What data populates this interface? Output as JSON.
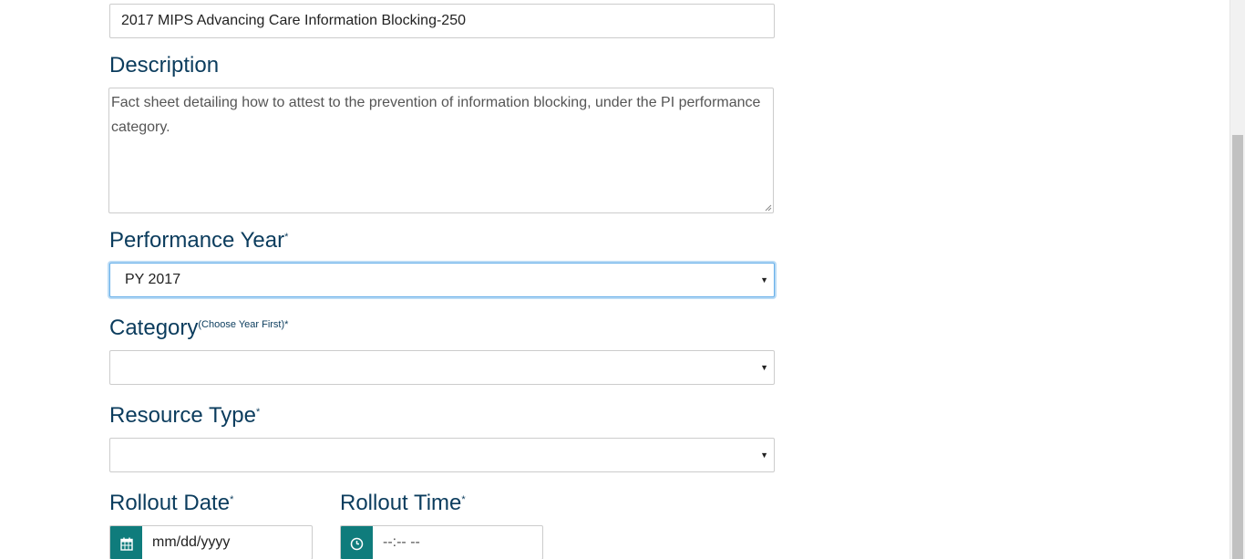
{
  "form": {
    "title_value": "2017 MIPS Advancing Care Information Blocking-250",
    "description": {
      "label": "Description",
      "value": "Fact sheet detailing how to attest to the prevention of information blocking, under the PI performance category."
    },
    "performance_year": {
      "label": "Performance Year",
      "required_mark": "*",
      "selected": "PY 2017"
    },
    "category": {
      "label": "Category",
      "hint": "(Choose Year First)*",
      "selected": ""
    },
    "resource_type": {
      "label": "Resource Type",
      "required_mark": "*",
      "selected": ""
    },
    "rollout_date": {
      "label": "Rollout Date",
      "required_mark": "*",
      "placeholder": "mm/dd/yyyy",
      "icon": "calendar-icon"
    },
    "rollout_time": {
      "label": "Rollout Time",
      "required_mark": "*",
      "placeholder": "--:-- --",
      "icon": "clock-icon"
    }
  },
  "colors": {
    "label": "#0b3c5d",
    "addon": "#0f7c7c",
    "focus": "#66afe9"
  }
}
